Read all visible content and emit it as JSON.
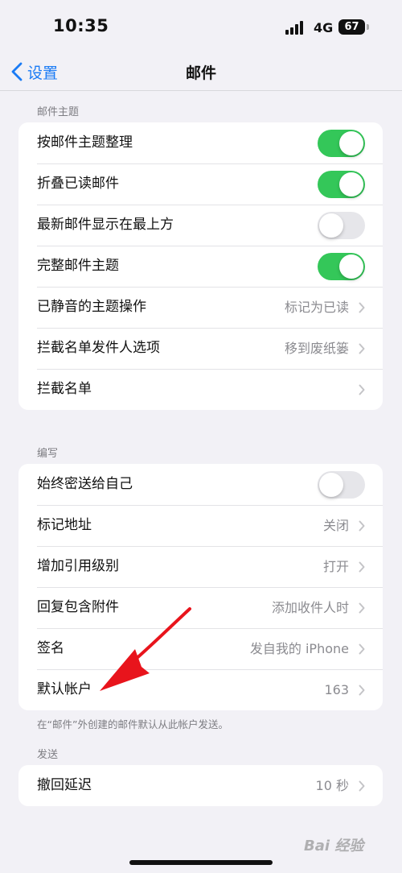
{
  "status_bar": {
    "time": "10:35",
    "network": "4G",
    "battery": "67"
  },
  "nav": {
    "back_label": "设置",
    "title": "邮件"
  },
  "sections": {
    "threading": {
      "header": "邮件主题",
      "rows": [
        {
          "label": "按邮件主题整理",
          "toggle": true
        },
        {
          "label": "折叠已读邮件",
          "toggle": true
        },
        {
          "label": "最新邮件显示在最上方",
          "toggle": false
        },
        {
          "label": "完整邮件主题",
          "toggle": true
        },
        {
          "label": "已静音的主题操作",
          "value": "标记为已读"
        },
        {
          "label": "拦截名单发件人选项",
          "value": "移到废纸篓"
        },
        {
          "label": "拦截名单",
          "value": ""
        }
      ]
    },
    "composing": {
      "header": "编写",
      "rows": [
        {
          "label": "始终密送给自己",
          "toggle": false
        },
        {
          "label": "标记地址",
          "value": "关闭"
        },
        {
          "label": "增加引用级别",
          "value": "打开"
        },
        {
          "label": "回复包含附件",
          "value": "添加收件人时"
        },
        {
          "label": "签名",
          "value": "发自我的 iPhone"
        },
        {
          "label": "默认帐户",
          "value": "163"
        }
      ],
      "footer": "在“邮件”外创建的邮件默认从此帐户发送。"
    },
    "sending": {
      "header": "发送",
      "rows": [
        {
          "label": "撤回延迟",
          "value": "10 秒"
        }
      ]
    }
  },
  "watermark": "Bai 经验",
  "colors": {
    "accent": "#1a7bf5",
    "toggle_on": "#34c759",
    "annotation_arrow": "#e8141c"
  }
}
